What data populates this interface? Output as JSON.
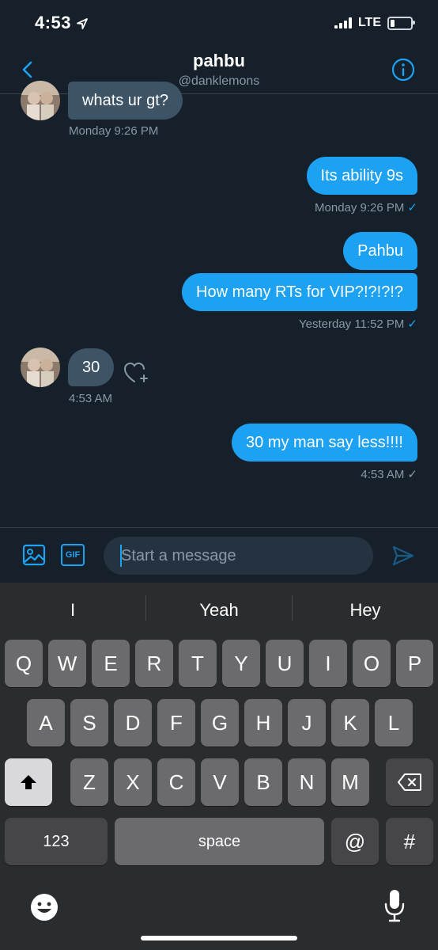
{
  "status_bar": {
    "time": "4:53",
    "network": "LTE",
    "location_icon": "location-arrow-icon",
    "battery_level": 0.2
  },
  "header": {
    "name": "pahbu",
    "handle": "@danklemons",
    "back_icon": "chevron-left-icon",
    "info_icon": "info-circle-icon"
  },
  "messages": [
    {
      "direction": "in",
      "text": "whats ur gt?",
      "meta": "Monday 9:26 PM"
    },
    {
      "direction": "out",
      "text": "Its ability 9s",
      "meta": "Monday 9:26 PM"
    },
    {
      "direction": "out",
      "text": "Pahbu",
      "meta": ""
    },
    {
      "direction": "out",
      "text": "How many RTs for VIP?!?!?!?",
      "meta": "Yesterday 11:52 PM"
    },
    {
      "direction": "in",
      "text": "30",
      "meta": "4:53 AM"
    },
    {
      "direction": "out",
      "text": "30 my man say less!!!!",
      "meta": "4:53 AM"
    }
  ],
  "checkmark": "✓",
  "composer": {
    "placeholder": "Start a message",
    "gif_label": "GIF",
    "image_icon": "image-icon",
    "send_icon": "send-icon"
  },
  "keyboard": {
    "suggestions": [
      "I",
      "Yeah",
      "Hey"
    ],
    "row1": [
      "Q",
      "W",
      "E",
      "R",
      "T",
      "Y",
      "U",
      "I",
      "O",
      "P"
    ],
    "row2": [
      "A",
      "S",
      "D",
      "F",
      "G",
      "H",
      "J",
      "K",
      "L"
    ],
    "row3": [
      "Z",
      "X",
      "C",
      "V",
      "B",
      "N",
      "M"
    ],
    "numbers_label": "123",
    "space_label": "space",
    "at_label": "@",
    "hash_label": "#"
  },
  "colors": {
    "background": "#15202b",
    "accent": "#1da1f2",
    "incoming_bubble": "#3d5466",
    "secondary_text": "#8899a6"
  }
}
